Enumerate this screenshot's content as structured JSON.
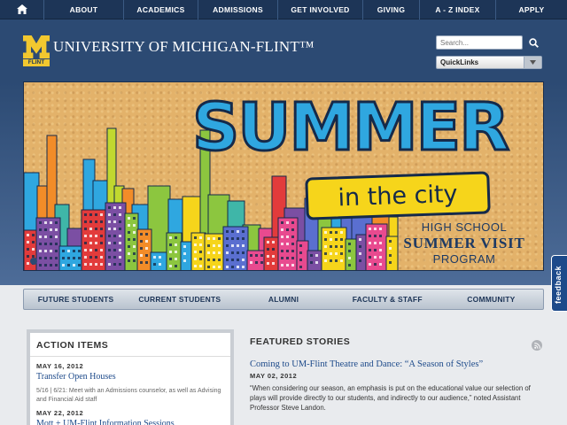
{
  "topnav": {
    "items": [
      "ABOUT",
      "ACADEMICS",
      "ADMISSIONS",
      "GET INVOLVED",
      "GIVING",
      "A - Z INDEX",
      "APPLY"
    ]
  },
  "header": {
    "logo_m": "M",
    "logo_flint": "FLINT",
    "site_title": "UNIVERSITY OF MICHIGAN-FLINT™",
    "search_placeholder": "Search...",
    "quicklinks_label": "QuickLinks"
  },
  "banner": {
    "headline": "SUMMER",
    "subheadline": "in the city",
    "line1": "HIGH SCHOOL",
    "line2": "SUMMER VISIT",
    "line3": "PROGRAM"
  },
  "subnav": {
    "items": [
      "FUTURE STUDENTS",
      "CURRENT STUDENTS",
      "ALUMNI",
      "FACULTY & STAFF",
      "COMMUNITY"
    ]
  },
  "action_items": {
    "title": "ACTION ITEMS",
    "entries": [
      {
        "date": "MAY 16, 2012",
        "title": "Transfer Open Houses",
        "desc": "5/16 | 6/21: Meet with an Admissions counselor, as well as Advising and Financial Aid staff"
      },
      {
        "date": "MAY 22, 2012",
        "title": "Mott + UM-Flint Information Sessions"
      }
    ]
  },
  "featured": {
    "title": "FEATURED STORIES",
    "story_title": "Coming to UM-Flint Theatre and Dance: “A Season of Styles”",
    "story_date": "MAY 02, 2012",
    "story_body": "“When considering our season, an emphasis is put on the educational value our selection of plays will provide directly to our students, and indirectly to our audience,” noted Assistant Professor Steve Landon."
  },
  "feedback": {
    "label": "feedback"
  },
  "colors": {
    "navy": "#1d3557",
    "header_blue": "#2c4a73",
    "maize": "#f2c82f",
    "link_blue": "#1d4a8a",
    "banner_cork": "#e3b26a",
    "summer_blue": "#2fa7e0",
    "callout_yellow": "#f6d51b"
  },
  "icons": [
    "home-icon",
    "search-icon",
    "chevron-down-icon",
    "rss-icon"
  ]
}
